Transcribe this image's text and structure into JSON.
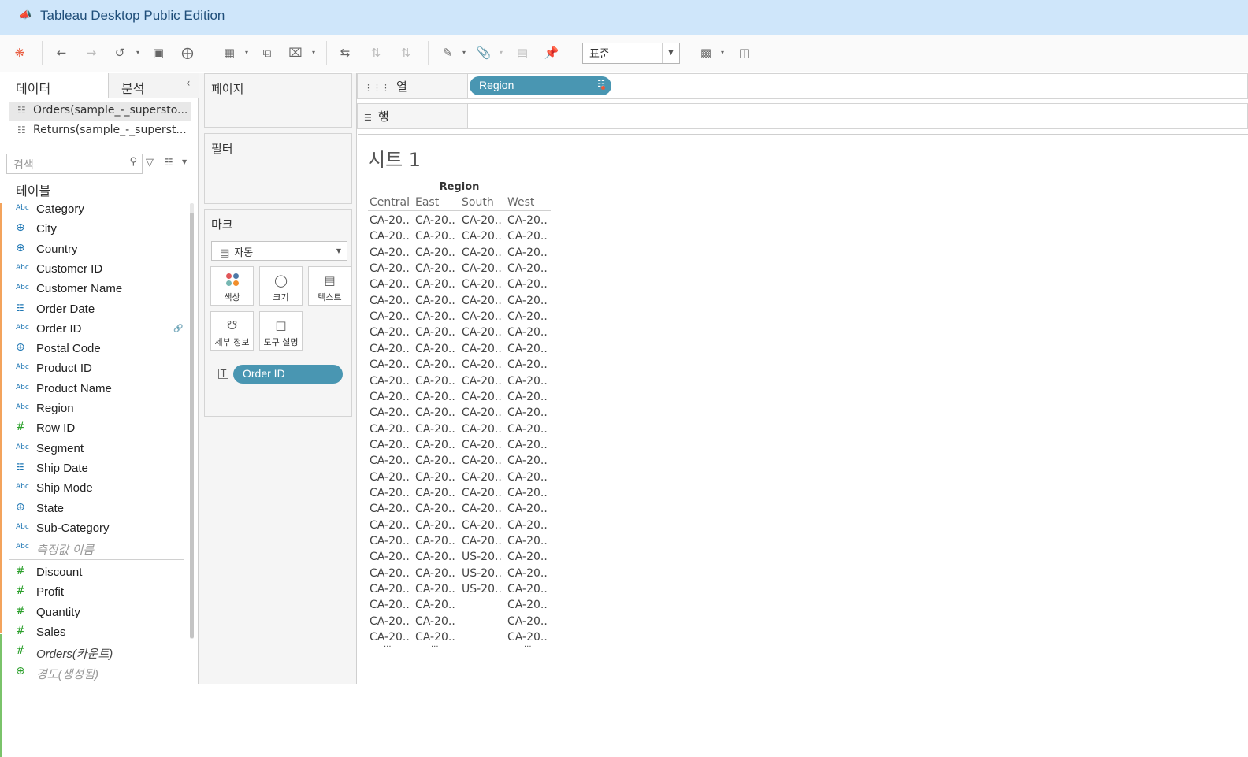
{
  "window": {
    "title": "Tableau Desktop Public Edition"
  },
  "toolbar": {
    "fit_value": "표준"
  },
  "data_pane": {
    "tab_data": "데이터",
    "tab_analysis": "분석",
    "datasources": [
      "Orders(sample_-_supersto...",
      "Returns(sample_-_superst..."
    ],
    "search_placeholder": "검색",
    "section_tables": "테이블",
    "fields": [
      {
        "name": "Category",
        "type": "Abc"
      },
      {
        "name": "City",
        "type": "geo"
      },
      {
        "name": "Country",
        "type": "geo"
      },
      {
        "name": "Customer ID",
        "type": "Abc"
      },
      {
        "name": "Customer Name",
        "type": "Abc"
      },
      {
        "name": "Order Date",
        "type": "date"
      },
      {
        "name": "Order ID",
        "type": "Abc",
        "linked": true
      },
      {
        "name": "Postal Code",
        "type": "geo"
      },
      {
        "name": "Product ID",
        "type": "Abc"
      },
      {
        "name": "Product Name",
        "type": "Abc"
      },
      {
        "name": "Region",
        "type": "Abc"
      },
      {
        "name": "Row ID",
        "type": "num"
      },
      {
        "name": "Segment",
        "type": "Abc"
      },
      {
        "name": "Ship Date",
        "type": "date"
      },
      {
        "name": "Ship Mode",
        "type": "Abc"
      },
      {
        "name": "State",
        "type": "geo"
      },
      {
        "name": "Sub-Category",
        "type": "Abc"
      },
      {
        "name": "측정값 이름",
        "type": "Abc",
        "style": "gray"
      },
      {
        "name": "Discount",
        "type": "num"
      },
      {
        "name": "Profit",
        "type": "num"
      },
      {
        "name": "Quantity",
        "type": "num"
      },
      {
        "name": "Sales",
        "type": "num"
      },
      {
        "name": "Orders(카운트)",
        "type": "num",
        "style": "italic"
      },
      {
        "name": "경도(생성됨)",
        "type": "geo-g",
        "style": "gray"
      }
    ]
  },
  "cards": {
    "pages": "페이지",
    "filters": "필터",
    "marks": "마크",
    "mark_type": "자동",
    "mark_buttons": [
      "색상",
      "크기",
      "텍스트",
      "세부 정보",
      "도구 설명"
    ],
    "mark_pill": "Order ID"
  },
  "shelves": {
    "columns_label": "열",
    "rows_label": "행",
    "columns_pill": "Region"
  },
  "sheet": {
    "title": "시트 1",
    "column_header_title": "Region",
    "columns": [
      "Central",
      "East",
      "South",
      "West"
    ],
    "rows": [
      [
        "CA-20..",
        "CA-20..",
        "CA-20..",
        "CA-20.."
      ],
      [
        "CA-20..",
        "CA-20..",
        "CA-20..",
        "CA-20.."
      ],
      [
        "CA-20..",
        "CA-20..",
        "CA-20..",
        "CA-20.."
      ],
      [
        "CA-20..",
        "CA-20..",
        "CA-20..",
        "CA-20.."
      ],
      [
        "CA-20..",
        "CA-20..",
        "CA-20..",
        "CA-20.."
      ],
      [
        "CA-20..",
        "CA-20..",
        "CA-20..",
        "CA-20.."
      ],
      [
        "CA-20..",
        "CA-20..",
        "CA-20..",
        "CA-20.."
      ],
      [
        "CA-20..",
        "CA-20..",
        "CA-20..",
        "CA-20.."
      ],
      [
        "CA-20..",
        "CA-20..",
        "CA-20..",
        "CA-20.."
      ],
      [
        "CA-20..",
        "CA-20..",
        "CA-20..",
        "CA-20.."
      ],
      [
        "CA-20..",
        "CA-20..",
        "CA-20..",
        "CA-20.."
      ],
      [
        "CA-20..",
        "CA-20..",
        "CA-20..",
        "CA-20.."
      ],
      [
        "CA-20..",
        "CA-20..",
        "CA-20..",
        "CA-20.."
      ],
      [
        "CA-20..",
        "CA-20..",
        "CA-20..",
        "CA-20.."
      ],
      [
        "CA-20..",
        "CA-20..",
        "CA-20..",
        "CA-20.."
      ],
      [
        "CA-20..",
        "CA-20..",
        "CA-20..",
        "CA-20.."
      ],
      [
        "CA-20..",
        "CA-20..",
        "CA-20..",
        "CA-20.."
      ],
      [
        "CA-20..",
        "CA-20..",
        "CA-20..",
        "CA-20.."
      ],
      [
        "CA-20..",
        "CA-20..",
        "CA-20..",
        "CA-20.."
      ],
      [
        "CA-20..",
        "CA-20..",
        "CA-20..",
        "CA-20.."
      ],
      [
        "CA-20..",
        "CA-20..",
        "CA-20..",
        "CA-20.."
      ],
      [
        "CA-20..",
        "CA-20..",
        "US-20..",
        "CA-20.."
      ],
      [
        "CA-20..",
        "CA-20..",
        "US-20..",
        "CA-20.."
      ],
      [
        "CA-20..",
        "CA-20..",
        "US-20..",
        "CA-20.."
      ],
      [
        "CA-20..",
        "CA-20..",
        "",
        "CA-20.."
      ],
      [
        "CA-20..",
        "CA-20..",
        "",
        "CA-20.."
      ],
      [
        "CA-20..",
        "CA-20..",
        "",
        "CA-20.."
      ]
    ],
    "more_marker": "..."
  },
  "colors": {
    "pill": "#4996b2",
    "titlebar": "#cfe6fa",
    "dimension": "#1f77b4",
    "measure": "#2ca02c"
  }
}
